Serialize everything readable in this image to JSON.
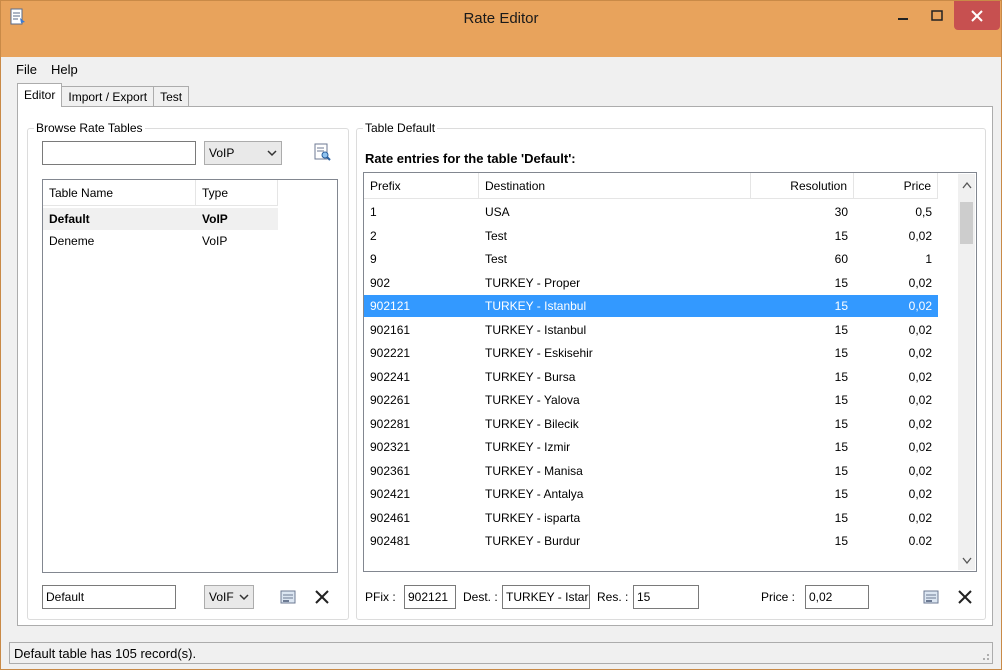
{
  "window": {
    "title": "Rate Editor",
    "accent_color": "#e8a35c",
    "close_color": "#c75050"
  },
  "menu": [
    "File",
    "Help"
  ],
  "tabs": [
    "Editor",
    "Import / Export",
    "Test"
  ],
  "browse": {
    "group_title": "Browse Rate Tables",
    "search_value": "",
    "type_filter": "VoIP",
    "columns": [
      "Table Name",
      "Type"
    ],
    "rows": [
      {
        "name": "Default",
        "type": "VoIP",
        "highlighted": true
      },
      {
        "name": "Deneme",
        "type": "VoIP",
        "highlighted": false
      }
    ],
    "edit_name": "Default",
    "edit_type": "VoIF"
  },
  "table": {
    "group_title": "Table Default",
    "heading": "Rate entries for the table 'Default':",
    "columns": [
      "Prefix",
      "Destination",
      "Resolution",
      "Price"
    ],
    "rows": [
      {
        "prefix": "1",
        "destination": "USA",
        "resolution": "30",
        "price": "0,5"
      },
      {
        "prefix": "2",
        "destination": "Test",
        "resolution": "15",
        "price": "0,02"
      },
      {
        "prefix": "9",
        "destination": "Test",
        "resolution": "60",
        "price": "1"
      },
      {
        "prefix": "902",
        "destination": "TURKEY - Proper",
        "resolution": "15",
        "price": "0,02"
      },
      {
        "prefix": "902121",
        "destination": "TURKEY - Istanbul",
        "resolution": "15",
        "price": "0,02"
      },
      {
        "prefix": "902161",
        "destination": "TURKEY - Istanbul",
        "resolution": "15",
        "price": "0,02"
      },
      {
        "prefix": "902221",
        "destination": "TURKEY - Eskisehir",
        "resolution": "15",
        "price": "0,02"
      },
      {
        "prefix": "902241",
        "destination": "TURKEY - Bursa",
        "resolution": "15",
        "price": "0,02"
      },
      {
        "prefix": "902261",
        "destination": "TURKEY - Yalova",
        "resolution": "15",
        "price": "0,02"
      },
      {
        "prefix": "902281",
        "destination": "TURKEY - Bilecik",
        "resolution": "15",
        "price": "0,02"
      },
      {
        "prefix": "902321",
        "destination": "TURKEY - Izmir",
        "resolution": "15",
        "price": "0,02"
      },
      {
        "prefix": "902361",
        "destination": "TURKEY - Manisa",
        "resolution": "15",
        "price": "0,02"
      },
      {
        "prefix": "902421",
        "destination": "TURKEY - Antalya",
        "resolution": "15",
        "price": "0,02"
      },
      {
        "prefix": "902461",
        "destination": "TURKEY - isparta",
        "resolution": "15",
        "price": "0,02"
      },
      {
        "prefix": "902481",
        "destination": "TURKEY - Burdur",
        "resolution": "15",
        "price": "0.02"
      }
    ],
    "selected_index": 4,
    "edit": {
      "prefix_label": "PFix :",
      "prefix_value": "902121",
      "dest_label": "Dest. :",
      "dest_value": "TURKEY - Istar",
      "res_label": "Res. :",
      "res_value": "15",
      "price_label": "Price :",
      "price_value": "0,02"
    }
  },
  "status": "Default table has 105 record(s)."
}
